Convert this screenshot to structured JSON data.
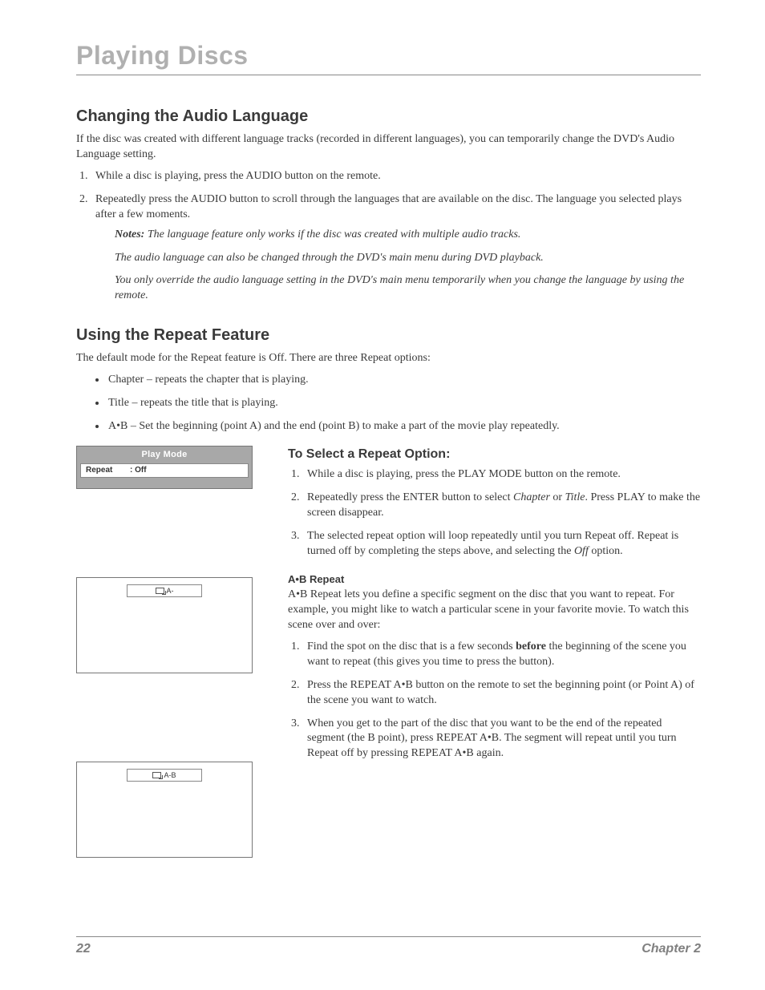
{
  "page_title": "Playing Discs",
  "sections": {
    "audio": {
      "heading": "Changing the Audio Language",
      "intro": "If the disc was created with different language tracks (recorded in different languages), you can temporarily change the DVD's Audio Language setting.",
      "steps": [
        "While a disc is playing, press the AUDIO button on the remote.",
        "Repeatedly press the AUDIO button to scroll through the languages that are available on the disc. The language you selected plays after a few moments."
      ],
      "notes_label": "Notes:",
      "notes": [
        "The language feature only works if the disc was created with multiple audio tracks.",
        "The audio language can also be changed through the DVD's main menu during DVD playback.",
        "You only override the audio language setting in the DVD's main menu temporarily when you change the language by using the remote."
      ]
    },
    "repeat": {
      "heading": "Using the Repeat Feature",
      "intro": "The default mode for the Repeat feature is Off. There are three Repeat options:",
      "options": [
        "Chapter – repeats the chapter that is playing.",
        "Title – repeats the title that is playing.",
        "A•B – Set the beginning (point A) and the end (point B) to make a part of the movie play repeatedly."
      ],
      "osd": {
        "title": "Play Mode",
        "row_key": "Repeat",
        "row_val": ": Off"
      },
      "screens": {
        "a": "A-",
        "ab": "A-B"
      },
      "select": {
        "heading": "To Select a Repeat Option:",
        "steps": [
          {
            "pre": "While a disc is playing, press the PLAY MODE button on the remote."
          },
          {
            "pre": "Repeatedly press the ENTER button to select ",
            "em1": "Chapter",
            "mid": " or ",
            "em2": "Title",
            "post": ". Press PLAY to make the screen disappear."
          },
          {
            "pre": "The selected repeat option will loop repeatedly until you turn Repeat off. Repeat is turned off by completing the steps above, and selecting the ",
            "em1": "Off",
            "post": " option."
          }
        ]
      },
      "ab": {
        "heading": "A•B Repeat",
        "intro": "A•B Repeat lets you define a specific segment on the disc that you want to repeat. For example, you might like to watch a particular scene in your favorite movie. To watch this scene over and over:",
        "steps": [
          {
            "pre": "Find the spot on the disc that is a few seconds ",
            "bold": "before",
            "post": " the beginning of the scene you want to repeat (this gives you time to press the button)."
          },
          {
            "text": "Press the REPEAT A•B button on the remote to set the beginning point (or Point A) of the scene you want to watch."
          },
          {
            "text": "When you get to the part of the disc that you want to be the end of the repeated segment (the B point), press REPEAT A•B. The segment will repeat until you turn Repeat off by pressing REPEAT A•B again."
          }
        ]
      }
    }
  },
  "footer": {
    "page": "22",
    "chapter": "Chapter 2"
  }
}
